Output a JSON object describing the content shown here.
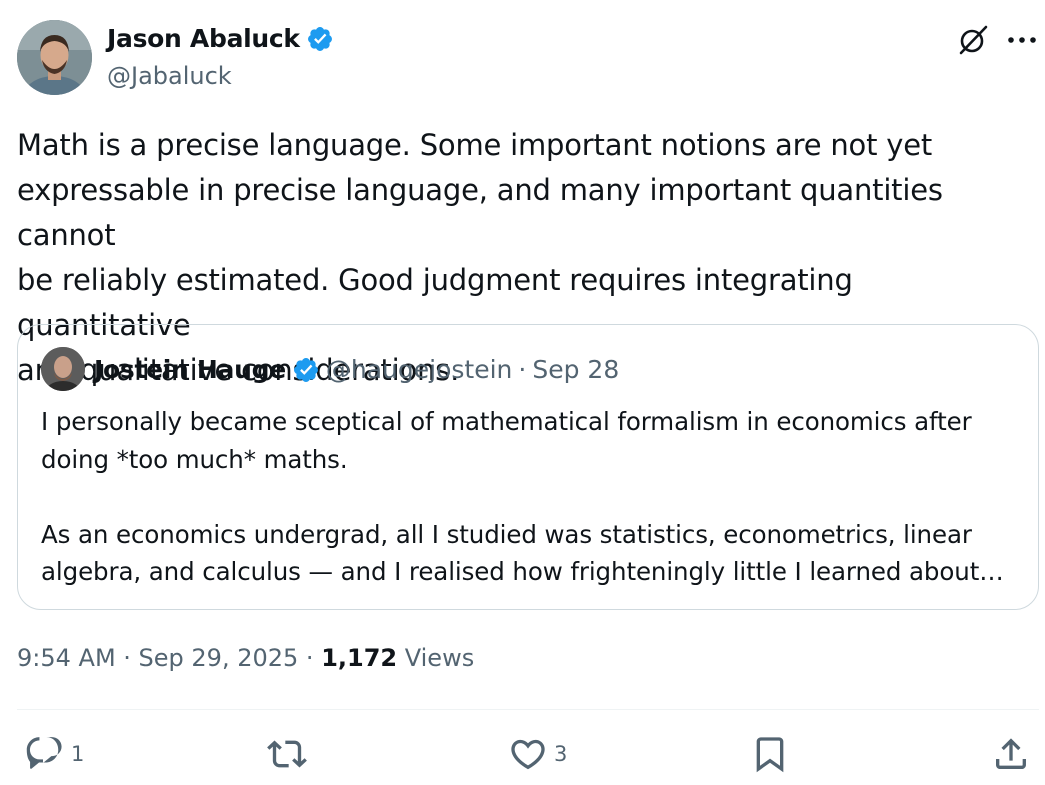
{
  "author": {
    "display_name": "Jason Abaluck",
    "handle": "@Jabaluck",
    "verified": true
  },
  "header_icons": [
    "grok-icon",
    "more-icon"
  ],
  "tweet_text": "Math is a precise language. Some important notions are not yet\nexpressable in precise language, and many important quantities cannot\nbe reliably estimated. Good judgment requires integrating quantitative\nand qualitative considerations.",
  "quote": {
    "display_name": "Jostein Hauge",
    "handle": "@haugejostein",
    "separator": "·",
    "date": "Sep 28",
    "verified": true,
    "text": "I personally became sceptical of mathematical formalism in economics after\ndoing *too much* maths.\n\nAs an economics undergrad, all I studied was statistics, econometrics, linear\nalgebra, and calculus — and I realised how frighteningly little I learned about…"
  },
  "meta": {
    "time": "9:54 AM",
    "sep1": " · ",
    "date": "Sep 29, 2025",
    "sep2": " · ",
    "views_count": "1,172",
    "views_label": " Views"
  },
  "actions": {
    "reply_count": "1",
    "repost_count": "",
    "like_count": "3"
  },
  "colors": {
    "text_primary": "#0f1419",
    "text_secondary": "#536471",
    "verified_blue": "#1d9bf0",
    "border": "#cfd9de"
  }
}
